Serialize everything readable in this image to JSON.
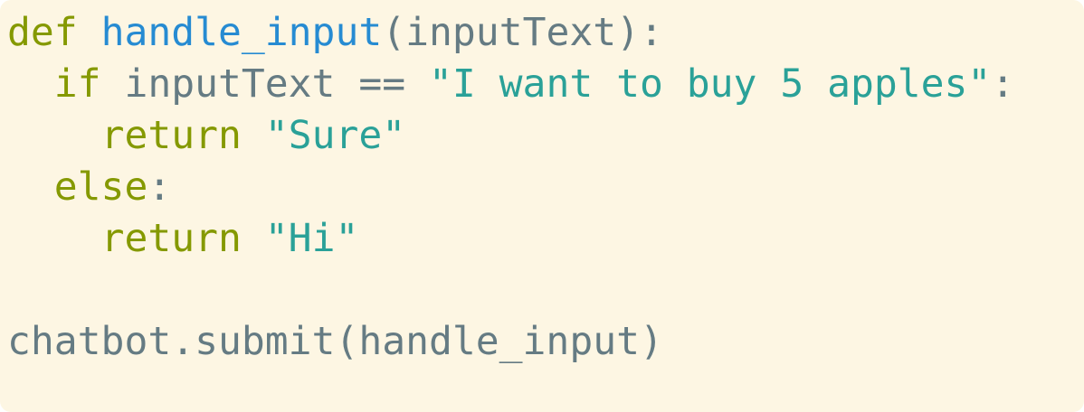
{
  "code": {
    "language": "python",
    "lines": [
      [
        {
          "text": "def",
          "kind": "keyword"
        },
        {
          "text": " ",
          "kind": "plain"
        },
        {
          "text": "handle_input",
          "kind": "func"
        },
        {
          "text": "(inputText):",
          "kind": "plain"
        }
      ],
      [
        {
          "text": "  ",
          "kind": "plain"
        },
        {
          "text": "if",
          "kind": "keyword"
        },
        {
          "text": " inputText == ",
          "kind": "plain"
        },
        {
          "text": "\"I want to buy 5 apples\"",
          "kind": "string"
        },
        {
          "text": ":",
          "kind": "plain"
        }
      ],
      [
        {
          "text": "    ",
          "kind": "plain"
        },
        {
          "text": "return",
          "kind": "keyword"
        },
        {
          "text": " ",
          "kind": "plain"
        },
        {
          "text": "\"Sure\"",
          "kind": "string"
        }
      ],
      [
        {
          "text": "  ",
          "kind": "plain"
        },
        {
          "text": "else",
          "kind": "keyword"
        },
        {
          "text": ":",
          "kind": "plain"
        }
      ],
      [
        {
          "text": "    ",
          "kind": "plain"
        },
        {
          "text": "return",
          "kind": "keyword"
        },
        {
          "text": " ",
          "kind": "plain"
        },
        {
          "text": "\"Hi\"",
          "kind": "string"
        }
      ],
      [],
      [
        {
          "text": "chatbot.submit(handle_input)",
          "kind": "plain"
        }
      ]
    ]
  },
  "colors": {
    "background": "#fdf6e3",
    "keyword": "#859900",
    "function": "#268bd2",
    "string": "#2aa198",
    "plain": "#657b83"
  }
}
